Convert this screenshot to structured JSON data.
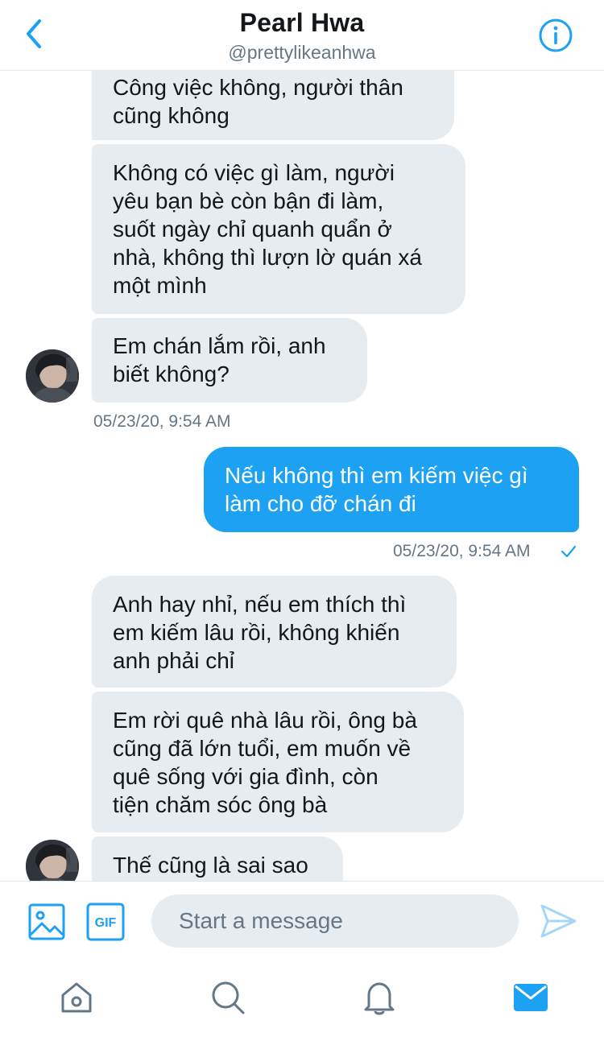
{
  "header": {
    "title": "Pearl Hwa",
    "handle": "@prettylikeanhwa"
  },
  "messages": [
    {
      "direction": "in",
      "text": "Công việc không, người thân\ncũng không"
    },
    {
      "direction": "in",
      "text": "Không có việc gì làm, người\nyêu bạn bè còn bận đi làm,\nsuốt ngày chỉ quanh quẩn ở\nnhà, không thì lượn lờ quán xá\nmột mình"
    },
    {
      "direction": "in",
      "text": "Em chán lắm rồi, anh\nbiết không?"
    },
    {
      "direction": "out",
      "text": "Nếu không thì em kiếm việc gì\nlàm cho đỡ chán đi"
    },
    {
      "direction": "in",
      "text": "Anh hay nhỉ, nếu em thích thì\nem kiếm lâu rồi, không khiến\nanh phải chỉ"
    },
    {
      "direction": "in",
      "text": "Em rời quê nhà lâu rồi, ông bà\ncũng đã lớn tuổi, em muốn về\nquê sống với gia đình, còn\ntiện chăm sóc ông bà"
    },
    {
      "direction": "in",
      "text": "Thế cũng là sai sao"
    }
  ],
  "timestamps": {
    "received": "05/23/20, 9:54 AM",
    "sent": "05/23/20, 9:54 AM"
  },
  "composer": {
    "placeholder": "Start a message",
    "gif_label": "GIF"
  },
  "icons": {
    "back": "chevron-left-icon",
    "info": "info-icon",
    "image": "image-icon",
    "gif": "gif-icon",
    "send": "send-icon",
    "home": "home-icon",
    "search": "search-icon",
    "notifications": "bell-icon",
    "messages": "mail-icon"
  },
  "colors": {
    "accent": "#1da1f2",
    "incoming_bubble": "#e6ecf0",
    "muted_text": "#657786"
  }
}
